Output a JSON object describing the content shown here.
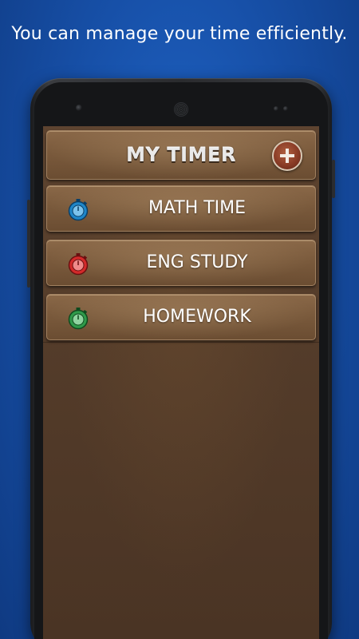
{
  "tagline": "You can manage your time efficiently.",
  "app": {
    "title": "MY TIMER",
    "add_icon": "plus-icon"
  },
  "timers": [
    {
      "label": "MATH TIME",
      "icon": "stopwatch-icon",
      "color": "#1f86c8"
    },
    {
      "label": "ENG STUDY",
      "icon": "stopwatch-icon",
      "color": "#d32a2a"
    },
    {
      "label": "HOMEWORK",
      "icon": "stopwatch-icon",
      "color": "#2f9a4a"
    }
  ],
  "colors": {
    "background": "#1750a8",
    "leather_light": "#8a6848",
    "leather_dark": "#4a3424",
    "add_button": "#8a3c26"
  }
}
